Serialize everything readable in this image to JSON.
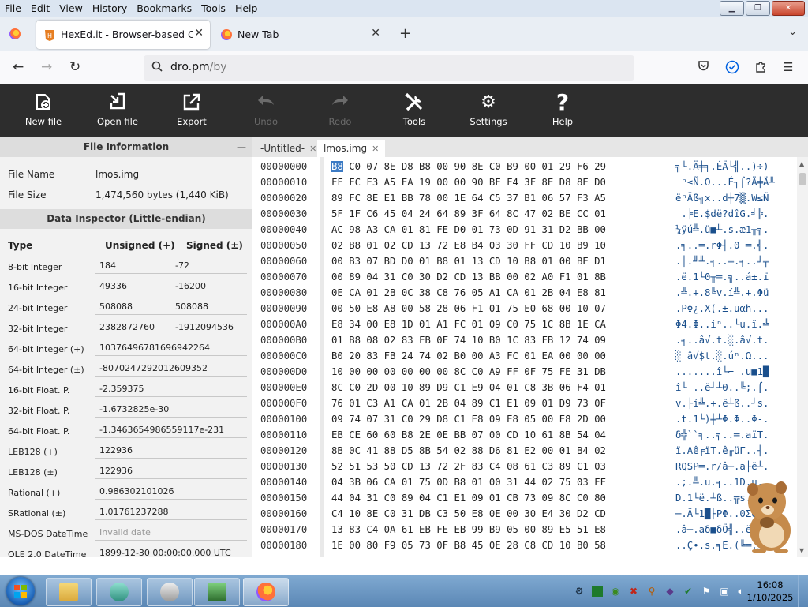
{
  "menubar": {
    "items": [
      "File",
      "Edit",
      "View",
      "History",
      "Bookmarks",
      "Tools",
      "Help"
    ]
  },
  "tabs": [
    {
      "title": "HexEd.it - Browser-based Online"
    },
    {
      "title": "New Tab"
    }
  ],
  "nav": {
    "url_host": "dro.pm",
    "url_path": "/by"
  },
  "toolbar": {
    "items": [
      {
        "label": "New file",
        "icon": "new-file-icon",
        "enabled": true
      },
      {
        "label": "Open file",
        "icon": "open-file-icon",
        "enabled": true
      },
      {
        "label": "Export",
        "icon": "export-icon",
        "enabled": true
      },
      {
        "label": "Undo",
        "icon": "undo-icon",
        "enabled": false
      },
      {
        "label": "Redo",
        "icon": "redo-icon",
        "enabled": false
      },
      {
        "label": "Tools",
        "icon": "tools-icon",
        "enabled": true
      },
      {
        "label": "Settings",
        "icon": "gear-icon",
        "enabled": true
      },
      {
        "label": "Help",
        "icon": "help-icon",
        "enabled": true
      }
    ]
  },
  "file_info": {
    "header": "File Information",
    "collapse": "—",
    "rows": [
      {
        "key": "File Name",
        "value": "lmos.img"
      },
      {
        "key": "File Size",
        "value": "1,474,560 bytes (1,440 KiB)"
      }
    ]
  },
  "inspector": {
    "header": "Data Inspector (Little-endian)",
    "collapse": "—",
    "col_type": "Type",
    "col_unsigned": "Unsigned (+)",
    "col_signed": "Signed (±)",
    "rows": [
      {
        "type": "8-bit Integer",
        "unsigned": "184",
        "signed": "-72"
      },
      {
        "type": "16-bit Integer",
        "unsigned": "49336",
        "signed": "-16200"
      },
      {
        "type": "24-bit Integer",
        "unsigned": "508088",
        "signed": "508088"
      },
      {
        "type": "32-bit Integer",
        "unsigned": "2382872760",
        "signed": "-1912094536"
      }
    ],
    "wide_rows": [
      {
        "type": "64-bit Integer (+)",
        "value": "10376496781696942264"
      },
      {
        "type": "64-bit Integer (±)",
        "value": "-8070247292012609352"
      },
      {
        "type": "16-bit Float. P.",
        "value": "-2.359375"
      },
      {
        "type": "32-bit Float. P.",
        "value": "-1.6732825e-30"
      },
      {
        "type": "64-bit Float. P.",
        "value": "-1.3463654986559117e-231"
      },
      {
        "type": "LEB128 (+)",
        "value": "122936"
      },
      {
        "type": "LEB128 (±)",
        "value": "122936"
      },
      {
        "type": "Rational (+)",
        "value": "0.986302101026"
      },
      {
        "type": "SRational (±)",
        "value": "1.01761237288"
      },
      {
        "type": "MS-DOS DateTime",
        "value": "Invalid date",
        "invalid": true
      },
      {
        "type": "OLE 2.0 DateTime",
        "value": "1899-12-30 00:00:00.000 UTC"
      }
    ]
  },
  "file_tabs": [
    {
      "name": "-Untitled-"
    },
    {
      "name": "lmos.img"
    }
  ],
  "hex": {
    "selected_byte": "B8",
    "rows": [
      {
        "offset": "00000000",
        "rest": "C0 07 8E D8 B8 00 90 8E C0 B9 00 01 29 F6 29",
        "ascii": "╗└.Ä╪╕.ÉÄ└╣..)÷)"
      },
      {
        "offset": "00000010",
        "bytes": "FF FC F3 A5 EA 19 00 00 90 BF F4 3F 8E D8 8E D0",
        "ascii": " ⁿ≤Ñ.Ω...É┐⌠?Ä╪Ä╨"
      },
      {
        "offset": "00000020",
        "bytes": "89 FC 8E E1 BB 78 00 1E 64 C5 37 B1 06 57 F3 A5",
        "ascii": "ëⁿÄß╗x..d┼7▒.W≤Ñ"
      },
      {
        "offset": "00000030",
        "bytes": "5F 1F C6 45 04 24 64 89 3F 64 8C 47 02 BE CC 01",
        "ascii": "_.╞E.$dë?dîG.╛╠."
      },
      {
        "offset": "00000040",
        "bytes": "AC 98 A3 CA 01 81 FE D0 01 73 0D 91 31 D2 BB 00",
        "ascii": "¼ÿú╩.ü■╨.s.æ1╥╗."
      },
      {
        "offset": "00000050",
        "bytes": "02 B8 01 02 CD 13 72 E8 B4 03 30 FF CD 10 B9 10",
        "ascii": ".╕..═.rΦ┤.0 ═.╣."
      },
      {
        "offset": "00000060",
        "bytes": "00 B3 07 BD D0 01 B8 01 13 CD 10 B8 01 00 BE D1",
        "ascii": ".│.╜╨.╕..═.╕..╛╤"
      },
      {
        "offset": "00000070",
        "bytes": "00 89 04 31 C0 30 D2 CD 13 BB 00 02 A0 F1 01 8B",
        "ascii": ".ë.1└0╥═.╗..á±.ï"
      },
      {
        "offset": "00000080",
        "bytes": "0E CA 01 2B 0C 38 C8 76 05 A1 CA 01 2B 04 E8 81",
        "ascii": ".╩.+.8╚v.í╩.+.Φü"
      },
      {
        "offset": "00000090",
        "bytes": "00 50 E8 A8 00 58 28 06 F1 01 75 E0 68 00 10 07",
        "ascii": ".PΦ¿.X(.±.uαh..."
      },
      {
        "offset": "000000A0",
        "bytes": "E8 34 00 E8 1D 01 A1 FC 01 09 C0 75 1C 8B 1E CA",
        "ascii": "Φ4.Φ..íⁿ..└u.ï.╩"
      },
      {
        "offset": "000000B0",
        "bytes": "01 B8 08 02 83 FB 0F 74 10 B0 1C 83 FB 12 74 09",
        "ascii": ".╕..â√.t.░.â√.t."
      },
      {
        "offset": "000000C0",
        "bytes": "B0 20 83 FB 24 74 02 B0 00 A3 FC 01 EA 00 00 00",
        "ascii": "░ â√$t.░.úⁿ.Ω..."
      },
      {
        "offset": "000000D0",
        "bytes": "10 00 00 00 00 00 00 8C C0 A9 FF 0F 75 FE 31 DB",
        "ascii": ".......î└⌐ .u■1█"
      },
      {
        "offset": "000000E0",
        "bytes": "8C C0 2D 00 10 89 D9 C1 E9 04 01 C8 3B 06 F4 01",
        "ascii": "î└-..ë┘┴Θ..╚;.⌠."
      },
      {
        "offset": "000000F0",
        "bytes": "76 01 C3 A1 CA 01 2B 04 89 C1 E1 09 01 D9 73 0F",
        "ascii": "v.├í╩.+.ë┴ß..┘s."
      },
      {
        "offset": "00000100",
        "bytes": "09 74 07 31 C0 29 D8 C1 E8 09 E8 05 00 E8 2D 00",
        "ascii": ".t.1└)╪┴Φ.Φ..Φ-."
      },
      {
        "offset": "00000110",
        "bytes": "EB CE 60 60 B8 2E 0E BB 07 00 CD 10 61 8B 54 04",
        "ascii": "δ╬``╕..╗..═.aïT."
      },
      {
        "offset": "00000120",
        "bytes": "8B 0C 41 88 D5 8B 54 02 88 D6 81 E2 00 01 B4 02",
        "ascii": "ï.Aê╒ïT.ê╓üΓ..┤."
      },
      {
        "offset": "00000130",
        "bytes": "52 51 53 50 CD 13 72 2F 83 C4 08 61 C3 89 C1 03",
        "ascii": "RQSP═.r/â─.a├ë┴."
      },
      {
        "offset": "00000140",
        "bytes": "04 3B 06 CA 01 75 0D B8 01 00 31 44 02 75 03 FF",
        "ascii": ".;.╩.u.╕..1D.u. "
      },
      {
        "offset": "00000150",
        "bytes": "44 04 31 C0 89 04 C1 E1 09 01 CB 73 09 8C C0 80",
        "ascii": "D.1└ë.┴ß..╦s.î└Ç"
      },
      {
        "offset": "00000160",
        "bytes": "C4 10 8E C0 31 DB C3 50 E8 0E 00 30 E4 30 D2 CD",
        "ascii": "─.Ä└1█├PΦ..0Σ0╥═"
      },
      {
        "offset": "00000170",
        "bytes": "13 83 C4 0A 61 EB FE EB 99 B9 05 00 89 E5 51 E8",
        "ascii": ".â─.aδ■δÖ╣..ëσQΦ"
      },
      {
        "offset": "00000180",
        "bytes": "1E 00 80 F9 05 73 0F B8 45 0E 28 C8 CD 10 B0 58",
        "ascii": "..Ç∙.s.╕E.(╚═.░X"
      }
    ]
  },
  "taskbar": {
    "clock_time": "16:08",
    "clock_date": "1/10/2025"
  }
}
